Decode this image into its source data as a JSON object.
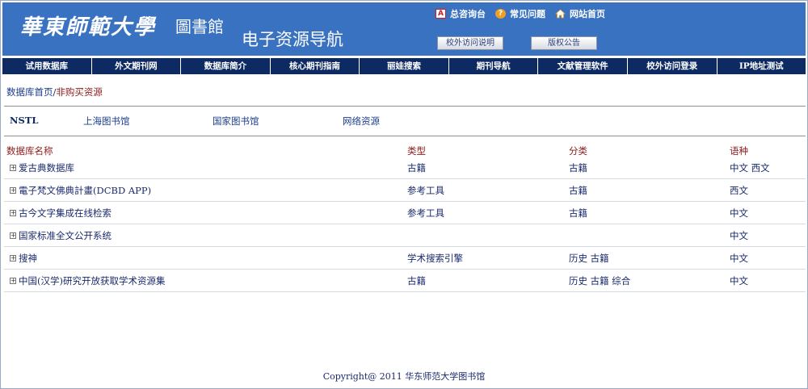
{
  "header": {
    "logo_text": "華東師範大學",
    "logo_sub": "圖書館",
    "site_title": "电子资源导航",
    "top_links": [
      {
        "label": "总咨询台",
        "icon": "consult-icon"
      },
      {
        "label": "常见问题",
        "icon": "help-icon"
      },
      {
        "label": "网站首页",
        "icon": "home-icon"
      }
    ],
    "offsite_button": "校外访问说明",
    "copyright_button": "版权公告"
  },
  "nav": {
    "items": [
      "试用数据库",
      "外文期刊网",
      "数据库简介",
      "核心期刊指南",
      "丽娃搜索",
      "期刊导航",
      "文献管理软件",
      "校外访问登录",
      "IP地址测试"
    ]
  },
  "breadcrumb": {
    "home": "数据库首页",
    "separator": "/",
    "current": "非购买资源"
  },
  "sub_links": {
    "items": [
      "NSTL",
      "上海图书馆",
      "国家图书馆",
      "网络资源"
    ]
  },
  "table": {
    "headers": {
      "name": "数据库名称",
      "type": "类型",
      "category": "分类",
      "language": "语种"
    },
    "rows": [
      {
        "name": "爱古典数据库",
        "type": "古籍",
        "category": "古籍",
        "language": "中文 西文"
      },
      {
        "name": "電子梵文佛典計畫(DCBD APP)",
        "type": "参考工具",
        "category": "古籍",
        "language": "西文"
      },
      {
        "name": "古今文字集成在线检索",
        "type": "参考工具",
        "category": "古籍",
        "language": "中文"
      },
      {
        "name": "国家标准全文公开系统",
        "type": "",
        "category": "",
        "language": "中文"
      },
      {
        "name": "搜神",
        "type": "学术搜索引擎",
        "category": "历史 古籍",
        "language": "中文"
      },
      {
        "name": "中国(汉学)研究开放获取学术资源集",
        "type": "古籍",
        "category": "历史 古籍 综合",
        "language": "中文"
      }
    ]
  },
  "footer": {
    "text": "Copyright@ 2011 华东师范大学图书馆"
  },
  "colors": {
    "header_bg": "#3a72c2",
    "nav_bg": "#0d2a63",
    "heading_red": "#8b1a1a",
    "link_blue": "#1a3c8a"
  }
}
